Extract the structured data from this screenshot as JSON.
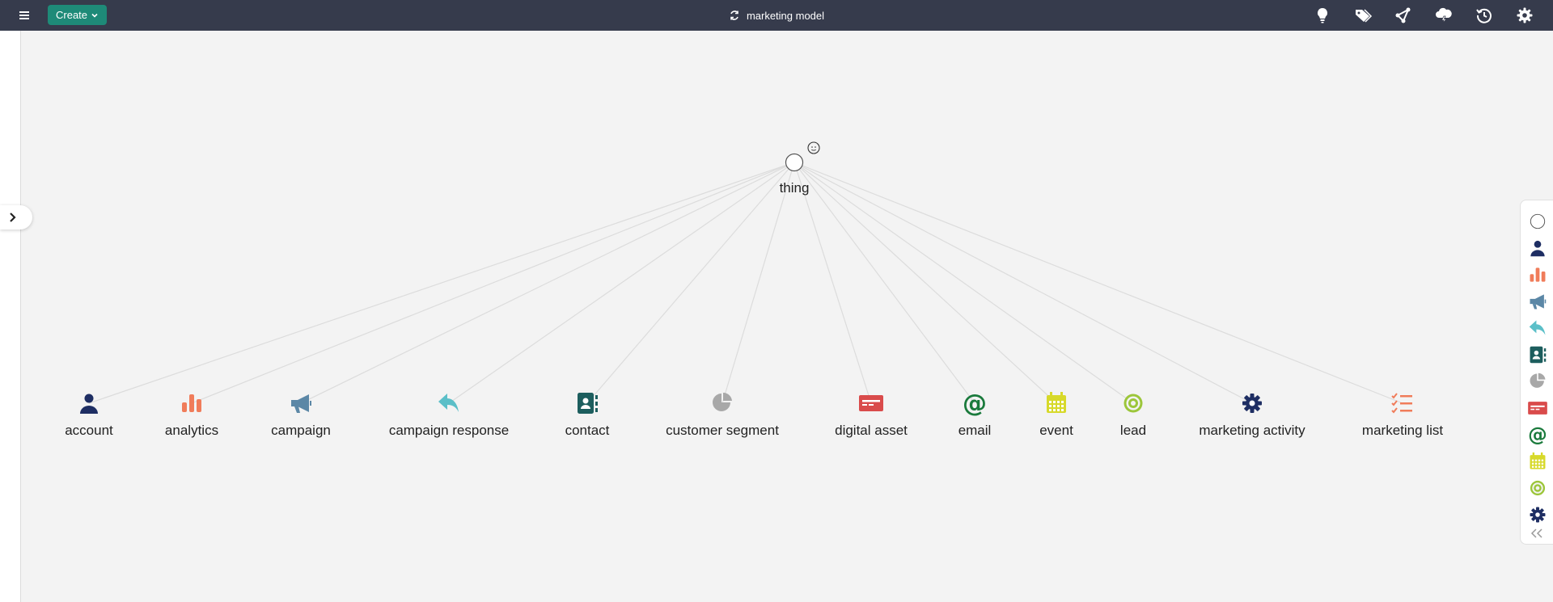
{
  "app": {
    "title": "marketing model",
    "create_label": "Create"
  },
  "toolbar": {
    "icons": [
      "lightbulb-icon",
      "tags-icon",
      "graph-share-icon",
      "cloud-lightning-icon",
      "history-icon",
      "gear-icon"
    ]
  },
  "graph": {
    "root": {
      "label": "thing",
      "icon": "circle-outline-icon"
    },
    "nodes": [
      {
        "label": "account",
        "icon": "person-icon",
        "color": "#1e2e63"
      },
      {
        "label": "analytics",
        "icon": "bar-chart-icon",
        "color": "#f07c5a"
      },
      {
        "label": "campaign",
        "icon": "megaphone-icon",
        "color": "#5b87a6"
      },
      {
        "label": "campaign response",
        "icon": "reply-arrow-icon",
        "color": "#5bbfc8"
      },
      {
        "label": "contact",
        "icon": "address-book-icon",
        "color": "#1d5e5e"
      },
      {
        "label": "customer segment",
        "icon": "pie-chart-icon",
        "color": "#a8a8a8"
      },
      {
        "label": "digital asset",
        "icon": "card-icon",
        "color": "#d94b4b"
      },
      {
        "label": "email",
        "icon": "at-sign-icon",
        "color": "#1a7a3c"
      },
      {
        "label": "event",
        "icon": "calendar-icon",
        "color": "#d7d92a"
      },
      {
        "label": "lead",
        "icon": "target-icon",
        "color": "#9cc63a"
      },
      {
        "label": "marketing activity",
        "icon": "gear-icon",
        "color": "#1e2e63"
      },
      {
        "label": "marketing list",
        "icon": "checklist-icon",
        "color": "#f07c5a"
      }
    ]
  },
  "palette": {
    "items": [
      "circle-outline-icon",
      "person-icon",
      "bar-chart-icon",
      "megaphone-icon",
      "reply-arrow-icon",
      "address-book-icon",
      "pie-chart-icon",
      "card-icon",
      "at-sign-icon",
      "calendar-icon",
      "target-icon",
      "gear-icon"
    ],
    "collapse_icon": "double-chevron-left-icon"
  },
  "colors": {
    "topbar": "#363b4c",
    "create_button": "#1e8a78",
    "edge": "#dcdcdc"
  }
}
